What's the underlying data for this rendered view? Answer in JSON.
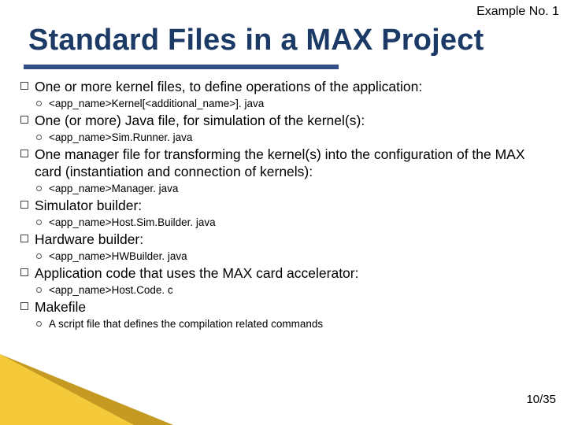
{
  "header": {
    "example_no": "Example No. 1"
  },
  "title": "Standard Files in a MAX Project",
  "items": [
    {
      "text": "One or more kernel files, to define operations of the application:",
      "sub": "<app_name>Kernel[<additional_name>]. java"
    },
    {
      "text": "One (or more) Java file, for simulation of the kernel(s):",
      "sub": "<app_name>Sim.Runner. java"
    },
    {
      "text": "One manager file for transforming the kernel(s) into the configuration of the MAX card (instantiation and connection of kernels):",
      "sub": "<app_name>Manager. java"
    },
    {
      "text": "Simulator builder:",
      "sub": "<app_name>Host.Sim.Builder. java"
    },
    {
      "text": "Hardware builder:",
      "sub": "<app_name>HWBuilder. java"
    },
    {
      "text": "Application code that uses the MAX card accelerator:",
      "sub": "<app_name>Host.Code. c"
    },
    {
      "text": "Makefile",
      "sub": "A script file that defines the compilation related commands"
    }
  ],
  "page": "10/35"
}
